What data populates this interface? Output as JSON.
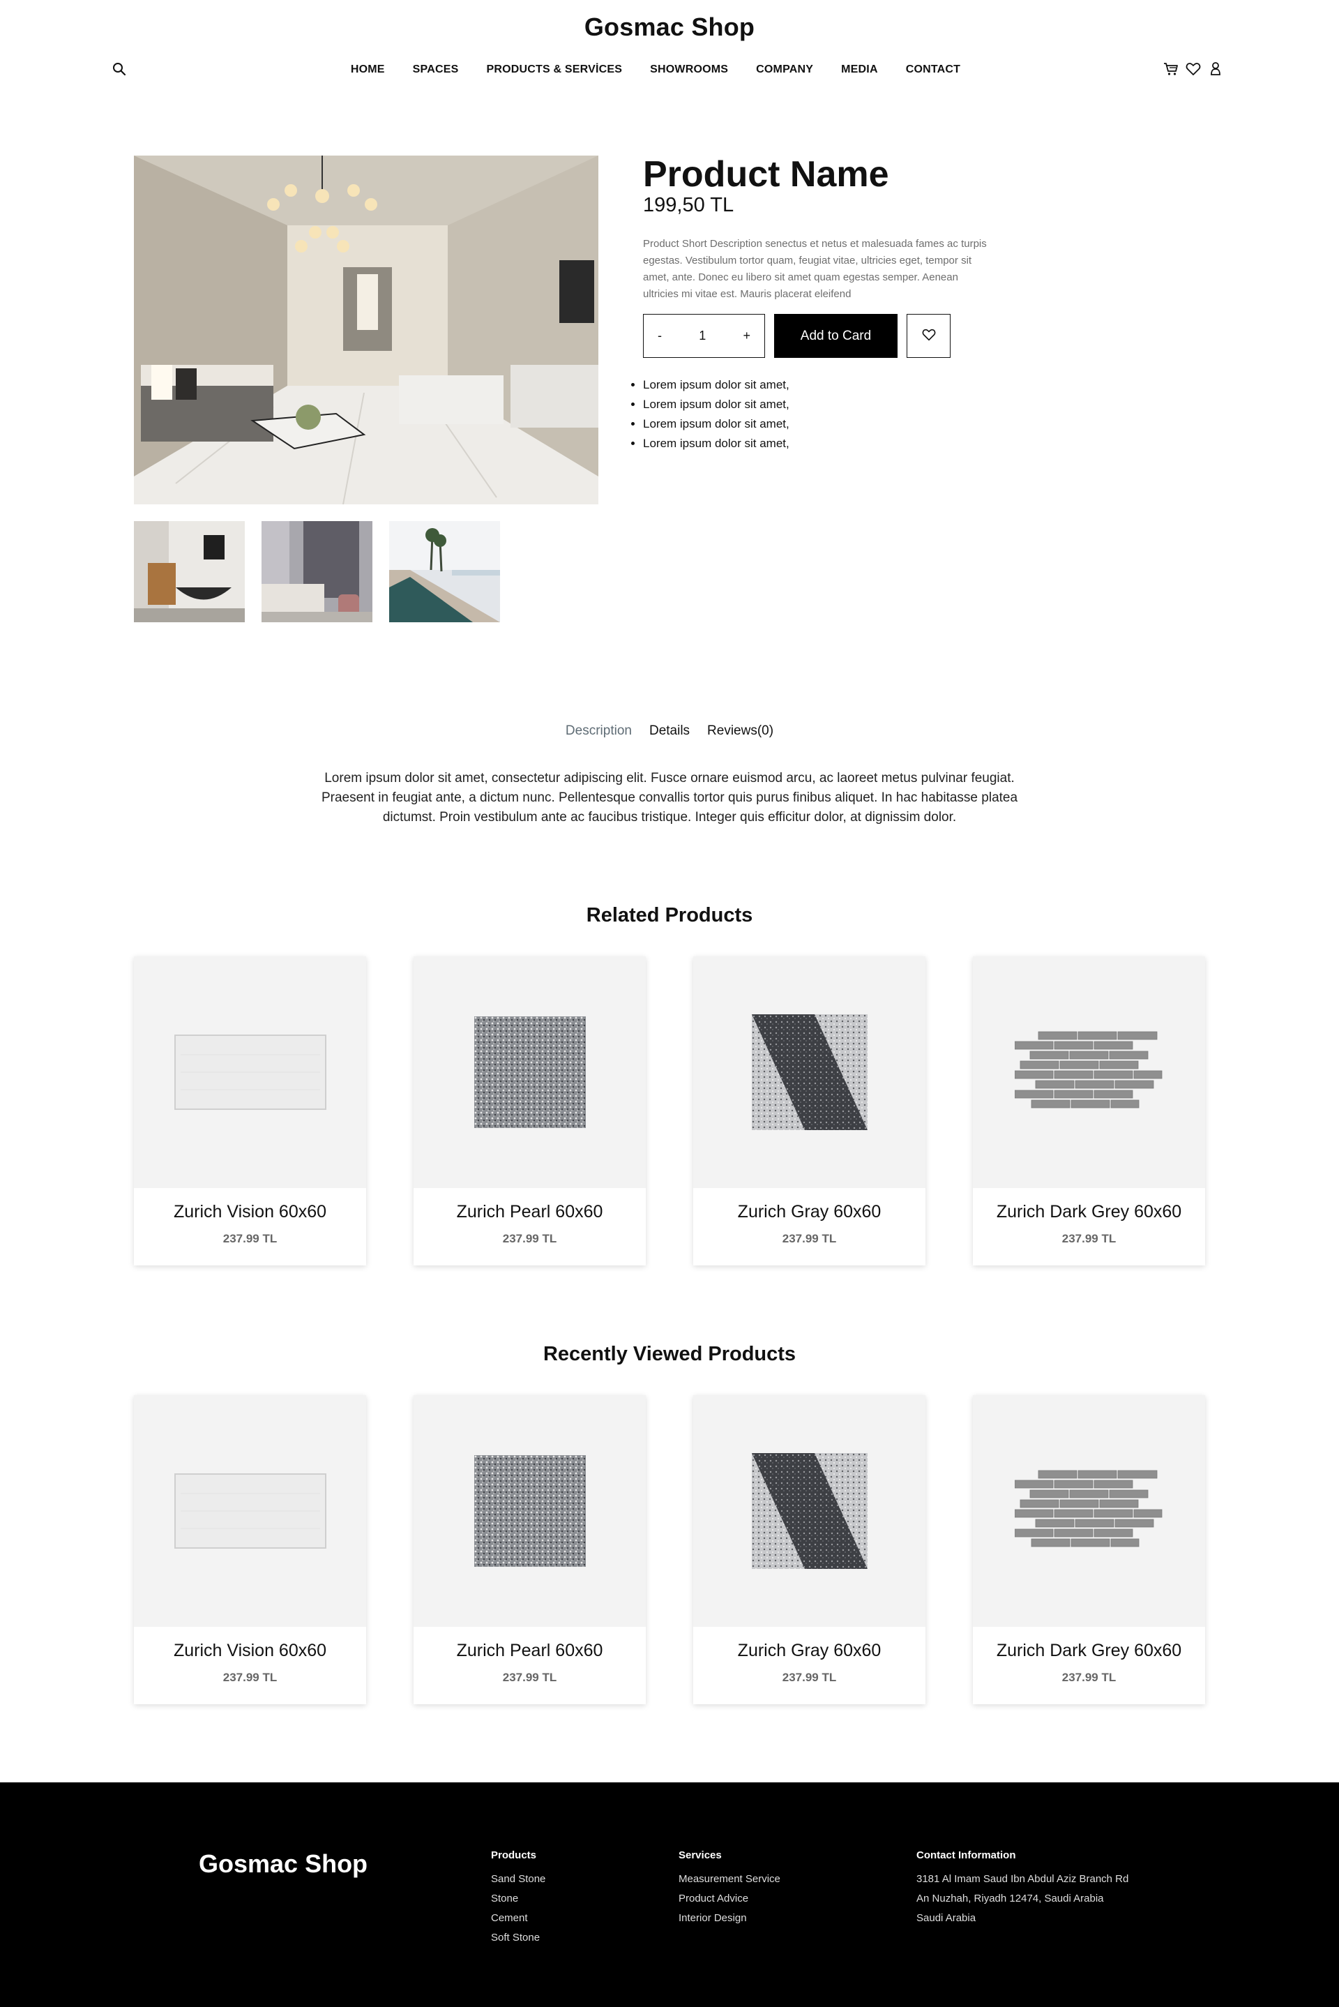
{
  "header": {
    "brand": "Gosmac Shop",
    "nav": [
      "HOME",
      "SPACES",
      "PRODUCTS & SERVİCES",
      "SHOWROOMS",
      "COMPANY",
      "MEDIA",
      "CONTACT"
    ]
  },
  "product": {
    "name": "Product Name",
    "price": "199,50 TL",
    "description": "Product Short Description senectus et netus et malesuada fames ac turpis egestas. Vestibulum tortor quam, feugiat vitae, ultricies eget, tempor sit amet, ante. Donec eu libero sit amet quam egestas semper. Aenean ultricies mi vitae est. Mauris placerat eleifend",
    "quantity": {
      "minus": "-",
      "value": "1",
      "plus": "+"
    },
    "add_button": "Add to Card",
    "bullets": [
      "Lorem ipsum dolor sit amet,",
      "Lorem ipsum dolor sit amet,",
      "Lorem ipsum dolor sit amet,",
      "Lorem ipsum dolor sit amet,"
    ]
  },
  "tabs": {
    "items": [
      "Description",
      "Details",
      "Reviews(0)"
    ],
    "active": "Description",
    "content": "Lorem ipsum dolor sit amet, consectetur adipiscing elit. Fusce ornare euismod arcu, ac laoreet metus pulvinar feugiat. Praesent in feugiat ante, a dictum nunc. Pellentesque convallis tortor quis purus finibus aliquet. In hac habitasse platea dictumst. Proin vestibulum ante ac faucibus tristique. Integer quis efficitur dolor, at dignissim dolor."
  },
  "related": {
    "title": "Related Products",
    "products": [
      {
        "name": "Zurich Vision 60x60",
        "price": "237.99 TL"
      },
      {
        "name": "Zurich Pearl 60x60",
        "price": "237.99 TL"
      },
      {
        "name": "Zurich Gray 60x60",
        "price": "237.99 TL"
      },
      {
        "name": "Zurich Dark Grey 60x60",
        "price": "237.99 TL"
      }
    ]
  },
  "recent": {
    "title": "Recently Viewed Products",
    "products": [
      {
        "name": "Zurich Vision 60x60",
        "price": "237.99 TL"
      },
      {
        "name": "Zurich Pearl 60x60",
        "price": "237.99 TL"
      },
      {
        "name": "Zurich Gray 60x60",
        "price": "237.99 TL"
      },
      {
        "name": "Zurich Dark Grey 60x60",
        "price": "237.99 TL"
      }
    ]
  },
  "footer": {
    "brand": "Gosmac Shop",
    "products": {
      "title": "Products",
      "links": [
        "Sand Stone",
        "Stone",
        "Cement",
        "Soft Stone"
      ]
    },
    "services": {
      "title": "Services",
      "links": [
        "Measurement Service",
        "Product Advice",
        "Interior Design"
      ]
    },
    "contact": {
      "title": "Contact Information",
      "lines": [
        "3181 Al Imam Saud Ibn Abdul Aziz Branch Rd",
        "An Nuzhah, Riyadh 12474, Saudi Arabia",
        "Saudi Arabia"
      ]
    }
  },
  "icons": {
    "search": "search-icon",
    "cart": "cart-icon",
    "wishlist": "heart-icon",
    "account": "user-icon"
  },
  "colors": {
    "primary": "#000000",
    "tab_active": "#5f6c75",
    "card_bg": "#f3f3f3",
    "muted_text": "#6e6e6e"
  }
}
